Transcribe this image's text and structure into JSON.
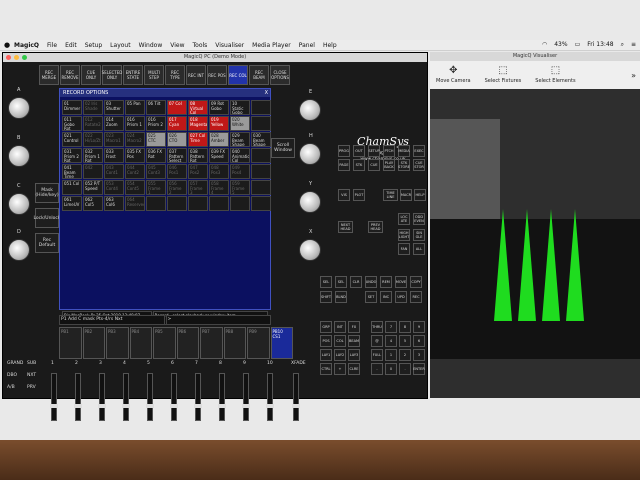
{
  "menubar": {
    "app_name": "MagicQ",
    "items": [
      "File",
      "Edit",
      "Setup",
      "Layout",
      "Window",
      "View",
      "Tools",
      "Visualiser",
      "Media Player",
      "Panel",
      "Help"
    ],
    "battery": "43%",
    "clock": "Fri 13:48"
  },
  "main_window": {
    "title": "MagicQ PC (Demo Mode)",
    "toolbar": [
      {
        "label": "REC MERGE",
        "active": false
      },
      {
        "label": "REC REMOVE",
        "active": false
      },
      {
        "label": "CUE ONLY",
        "active": false
      },
      {
        "label": "SELECTED ONLY",
        "active": false
      },
      {
        "label": "ENTIRE STATE",
        "active": false
      },
      {
        "label": "MULTI STEP",
        "active": false
      },
      {
        "label": "REC TYPE",
        "active": false
      },
      {
        "label": "REC INT",
        "active": false
      },
      {
        "label": "REC POS",
        "active": false
      },
      {
        "label": "REC COL",
        "active": true
      },
      {
        "label": "REC BEAM",
        "active": false
      },
      {
        "label": "CLOSE OPTIONS",
        "active": false
      }
    ],
    "encoders_left": [
      "A",
      "B",
      "C",
      "D"
    ],
    "encoders_right": [
      "E",
      "Y",
      "X",
      "H"
    ],
    "side_buttons": [
      "Mask (Hide/key)",
      "Lock/Unlock",
      "Rec Default",
      "Scroll Window"
    ]
  },
  "record_dialog": {
    "title": "RECORD OPTIONS",
    "close": "X",
    "cells": [
      {
        "t": "01 Dimmer",
        "s": ""
      },
      {
        "t": "02 Iris Shade",
        "s": "dim"
      },
      {
        "t": "03 Shutter",
        "s": ""
      },
      {
        "t": "05 Pan",
        "s": ""
      },
      {
        "t": "06 Tilt",
        "s": ""
      },
      {
        "t": "07 Col",
        "s": "red"
      },
      {
        "t": "08 Virtual Col",
        "s": "red"
      },
      {
        "t": "09 Rot Gobo",
        "s": ""
      },
      {
        "t": "10 Static Gobo",
        "s": ""
      },
      {
        "t": "",
        "s": ""
      },
      {
        "t": "011 Gobo Rot",
        "s": ""
      },
      {
        "t": "012 Rotate2",
        "s": "dim"
      },
      {
        "t": "014 Zoom",
        "s": ""
      },
      {
        "t": "016 Prism 1",
        "s": ""
      },
      {
        "t": "016 Prism 2",
        "s": ""
      },
      {
        "t": "017 Cyan",
        "s": "red"
      },
      {
        "t": "018 Magenta",
        "s": "red"
      },
      {
        "t": "019 Yellow",
        "s": "red"
      },
      {
        "t": "020 White",
        "s": "gray"
      },
      {
        "t": "",
        "s": ""
      },
      {
        "t": "021 Control",
        "s": ""
      },
      {
        "t": "022 Hi/Lo/Zt",
        "s": "dim"
      },
      {
        "t": "023 Macro1",
        "s": "dim"
      },
      {
        "t": "024 Macro2",
        "s": "dim"
      },
      {
        "t": "025 CTC",
        "s": "gray"
      },
      {
        "t": "026 CTO",
        "s": "gray"
      },
      {
        "t": "027 Col Time",
        "s": "red"
      },
      {
        "t": "028 Amber",
        "s": "gray"
      },
      {
        "t": "029 Beam Shape",
        "s": ""
      },
      {
        "t": "030 Beam Shape Rot",
        "s": ""
      },
      {
        "t": "031 Prism 2 Rot",
        "s": ""
      },
      {
        "t": "032 Prism 1 Rot",
        "s": ""
      },
      {
        "t": "033 Frost",
        "s": ""
      },
      {
        "t": "035 FX Pos",
        "s": ""
      },
      {
        "t": "036 FX Rot",
        "s": ""
      },
      {
        "t": "037 Pattern Select",
        "s": ""
      },
      {
        "t": "038 Pattern Rot",
        "s": ""
      },
      {
        "t": "039 FX Speed",
        "s": ""
      },
      {
        "t": "040 Animation Col",
        "s": ""
      },
      {
        "t": "",
        "s": ""
      },
      {
        "t": "041 Beam Time",
        "s": ""
      },
      {
        "t": "042",
        "s": "dim"
      },
      {
        "t": "043 Cont1",
        "s": "dim"
      },
      {
        "t": "044 Cont2",
        "s": "dim"
      },
      {
        "t": "045 Cont3",
        "s": "dim"
      },
      {
        "t": "046 Pos1",
        "s": "dim"
      },
      {
        "t": "047 Pos2",
        "s": "dim"
      },
      {
        "t": "048 Pos3",
        "s": "dim"
      },
      {
        "t": "049 Pos4",
        "s": "dim"
      },
      {
        "t": "",
        "s": ""
      },
      {
        "t": "051 Col",
        "s": ""
      },
      {
        "t": "052 P/T Speed",
        "s": ""
      },
      {
        "t": "053 Cont4",
        "s": "dim"
      },
      {
        "t": "054 Cont5",
        "s": "dim"
      },
      {
        "t": "055 Frame 1",
        "s": "dim"
      },
      {
        "t": "056 Frame 2",
        "s": "dim"
      },
      {
        "t": "057 Frame 3",
        "s": "dim"
      },
      {
        "t": "058 Frame 4",
        "s": "dim"
      },
      {
        "t": "059 Frame 5",
        "s": "dim"
      },
      {
        "t": "",
        "s": ""
      },
      {
        "t": "061 LimeUV",
        "s": ""
      },
      {
        "t": "062 Col5",
        "s": ""
      },
      {
        "t": "063 Col6",
        "s": ""
      },
      {
        "t": "064 Reserved",
        "s": "dim"
      },
      {
        "t": "",
        "s": ""
      },
      {
        "t": "",
        "s": ""
      },
      {
        "t": "",
        "s": ""
      },
      {
        "t": "",
        "s": ""
      },
      {
        "t": "",
        "s": ""
      },
      {
        "t": "",
        "s": ""
      }
    ],
    "status_left": "Bis-MacBook-Pr 25 Oct 2019 13:48:07",
    "status_right": "Record - select playback or window item",
    "cmd_left": "P1 Add C mask Pts-4/rs Nxt",
    "cmd_right": ">"
  },
  "playbacks": {
    "labels": [
      "PB1",
      "PB2",
      "PB3",
      "PB4",
      "PB5",
      "PB6",
      "PB7",
      "PB8",
      "PB9",
      "PB10 CS1"
    ]
  },
  "faders": {
    "labels": [
      "GRAND",
      "SUB",
      "1",
      "2",
      "3",
      "4",
      "5",
      "6",
      "7",
      "8",
      "9",
      "10",
      "XFADE"
    ],
    "row2": [
      "DBO",
      "NXT",
      "A/B",
      "PRV"
    ]
  },
  "right_panel": {
    "logo": "ChamSys",
    "subtitle": "MagicQ",
    "url": "www.chamsys.co.uk",
    "row1": [
      "PROG",
      "OUT",
      "SETUP",
      "PTCH",
      "MEDIA",
      "EXEC"
    ],
    "row2": [
      "PAGE",
      "STK",
      "CUE",
      "PLAY BACK",
      "STK STORE",
      "CUE STOR"
    ],
    "row3": [
      "VIS",
      "PLOT",
      "TIME LINE",
      "MACR",
      "HELP"
    ],
    "row4": [
      "NEXT HEAD",
      "PREV HEAD",
      "LOC ATE",
      "ODD EVEN"
    ],
    "row5": [
      "HIGH LIGHT",
      "SIN GLE",
      "FAN",
      "ALL"
    ],
    "keys1": [
      "SEL",
      "SEL",
      "CLR",
      "UNDO",
      "REM",
      "MOVE",
      "COPY"
    ],
    "keys2": [
      "SHIFT",
      "BLND",
      "SET",
      "INC",
      "UPD",
      "REC"
    ],
    "keypad": [
      "GRP",
      "INT",
      "FX",
      "THRU",
      "7",
      "8",
      "9",
      "POS",
      "COL",
      "BEAM",
      "@",
      "4",
      "5",
      "6",
      "LAY1",
      "LAY2",
      "LAY3",
      "FULL",
      "1",
      "2",
      "3",
      "CTRL",
      "+",
      "CLRE",
      "-",
      "0",
      ".",
      "ENTER"
    ]
  },
  "visualiser": {
    "title": "MagicQ Visualiser",
    "tools": [
      {
        "icon": "move-icon",
        "label": "Move Camera"
      },
      {
        "icon": "fixtures-icon",
        "label": "Select Fixtures"
      },
      {
        "icon": "elements-icon",
        "label": "Select Elements"
      }
    ],
    "more": "»",
    "beam_color": "#1fdc1f",
    "beam_count": 4
  }
}
